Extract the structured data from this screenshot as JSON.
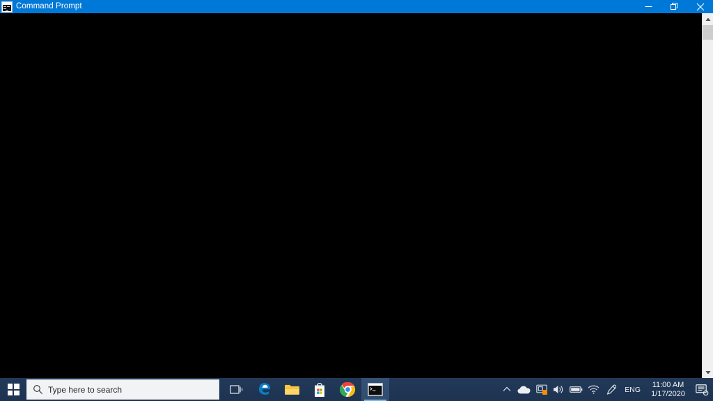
{
  "window": {
    "title": "Command Prompt",
    "icon": "command-prompt-icon",
    "titlebar_color": "#0078d7",
    "console_background": "#000000",
    "console_text": "",
    "controls": {
      "minimize_label": "Minimize",
      "maximize_label": "Restore",
      "close_label": "Close"
    }
  },
  "scrollbar": {
    "up_arrow_label": "Scroll up",
    "down_arrow_label": "Scroll down",
    "thumb_label": "Scrollbar thumb"
  },
  "taskbar": {
    "background_color": "#1f3a5f",
    "start": {
      "label": "Start",
      "icon": "windows-logo-icon"
    },
    "search": {
      "placeholder": "Type here to search",
      "icon": "search-icon"
    },
    "apps": [
      {
        "name": "task-view",
        "label": "Task View",
        "icon": "task-view-icon",
        "active": false
      },
      {
        "name": "microsoft-edge",
        "label": "Microsoft Edge",
        "icon": "edge-icon",
        "active": false
      },
      {
        "name": "file-explorer",
        "label": "File Explorer",
        "icon": "folder-icon",
        "active": false
      },
      {
        "name": "microsoft-store",
        "label": "Microsoft Store",
        "icon": "store-icon",
        "active": false
      },
      {
        "name": "google-chrome",
        "label": "Google Chrome",
        "icon": "chrome-icon",
        "active": false
      },
      {
        "name": "command-prompt",
        "label": "Command Prompt",
        "icon": "command-prompt-icon",
        "active": true
      }
    ],
    "tray": [
      {
        "name": "show-hidden-icons",
        "label": "Show hidden icons",
        "icon": "chevron-up-icon"
      },
      {
        "name": "onedrive",
        "label": "OneDrive",
        "icon": "cloud-icon"
      },
      {
        "name": "display-settings",
        "label": "Display",
        "icon": "display-icon",
        "badge": "#ff8c00"
      },
      {
        "name": "volume",
        "label": "Speakers",
        "icon": "speaker-icon"
      },
      {
        "name": "battery",
        "label": "Battery",
        "icon": "battery-icon"
      },
      {
        "name": "network",
        "label": "Network",
        "icon": "wifi-icon"
      },
      {
        "name": "pen-workspace",
        "label": "Windows Ink Workspace",
        "icon": "pen-icon"
      }
    ],
    "language": "ENG",
    "clock": {
      "time": "11:00 AM",
      "date": "1/17/2020"
    },
    "action_center": {
      "label": "Action Center",
      "icon": "notification-icon"
    }
  }
}
